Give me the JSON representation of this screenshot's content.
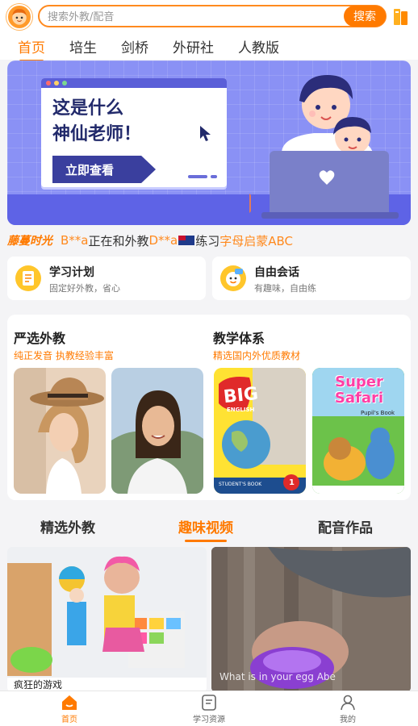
{
  "search": {
    "placeholder": "搜索外教/配音",
    "button_label": "搜索"
  },
  "tabs": [
    {
      "label": "首页",
      "active": true
    },
    {
      "label": "培生"
    },
    {
      "label": "剑桥"
    },
    {
      "label": "外研社"
    },
    {
      "label": "人教版"
    }
  ],
  "banner": {
    "line1": "这是什么",
    "line2": "神仙老师！",
    "cta": "立即查看"
  },
  "ticker": {
    "brand": "藤蔓时光",
    "user1": "B**a",
    "text1": "正在和外教",
    "user2": "D**a",
    "text2": "练习",
    "course": "字母启蒙ABC"
  },
  "features": [
    {
      "title": "学习计划",
      "subtitle": "固定好外教，省心",
      "icon": "notepad-icon"
    },
    {
      "title": "自由会话",
      "subtitle": "有趣味，自由练",
      "icon": "chat-face-icon"
    }
  ],
  "section": {
    "left": {
      "title": "严选外教",
      "subtitle": "纯正发音 执教经验丰富"
    },
    "right": {
      "title": "教学体系",
      "subtitle": "精选国内外优质教材"
    }
  },
  "books": [
    {
      "title": "BIG",
      "subtitle": "ENGLISH",
      "footer": "STUDENT'S BOOK",
      "level": "1"
    },
    {
      "title": "Super Safari",
      "subtitle": "Pupil's Book"
    }
  ],
  "video_tabs": [
    {
      "label": "精选外教"
    },
    {
      "label": "趣味视频",
      "active": true
    },
    {
      "label": "配音作品"
    }
  ],
  "videos": [
    {
      "caption": "疯狂的游戏"
    },
    {
      "overlay": "What is in your egg Abe"
    }
  ],
  "bottom_nav": [
    {
      "label": "首页",
      "icon": "home-icon",
      "active": true
    },
    {
      "label": "学习资源",
      "icon": "document-icon"
    },
    {
      "label": "我的",
      "icon": "profile-icon"
    }
  ],
  "colors": {
    "accent": "#ff7a00",
    "banner": "#8a91f5"
  }
}
